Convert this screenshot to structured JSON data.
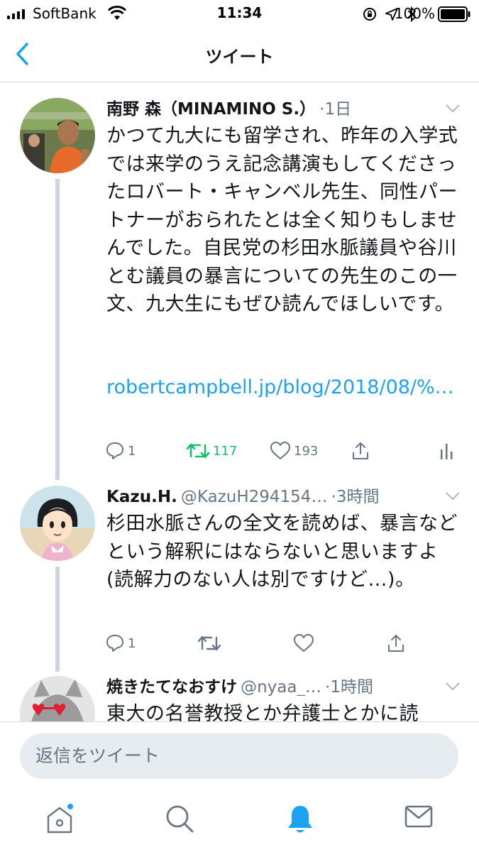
{
  "status_bar": {
    "carrier": "SoftBank",
    "time": "11:34",
    "battery": "100%"
  },
  "nav": {
    "title": "ツイート"
  },
  "tweets": [
    {
      "name": "南野 森（MINAMINO S.）",
      "handle": "",
      "time": "·1日",
      "text": "かつて九大にも留学され、昨年の入学式では来学のうえ記念講演もしてくださったロバート・キャンベル先生、同性パートナーがおられたとは全く知りもしませんでした。自民党の杉田水脈議員や谷川とむ議員の暴言についての先生のこの一文、九大生にもぜひ読んでほしいです。",
      "link": "robertcampbell.jp/blog/2018/08/%…",
      "replies": "1",
      "retweets": "117",
      "likes": "193"
    },
    {
      "name": "Kazu.H.",
      "handle": "@KazuH294154…",
      "time": "·3時間",
      "text": "杉田水脈さんの全文を読めば、暴言などという解釈にはならないと思いますよ(読解力のない人は別ですけど…)。",
      "replies": "1"
    },
    {
      "name": "焼きたてなおすけ",
      "handle": "@nyaa_…",
      "time": "·1時間",
      "text": "東大の名誉教授とか弁護士とかに読"
    }
  ],
  "reply": {
    "placeholder": "返信をツイート"
  },
  "tabs": [
    "home-icon",
    "search-icon",
    "notifications-icon",
    "messages-icon"
  ],
  "colors": {
    "accent": "#1da1f2",
    "retweet": "#17bf63",
    "secondary_text": "#657786",
    "thread_line": "#ccd6dd"
  }
}
